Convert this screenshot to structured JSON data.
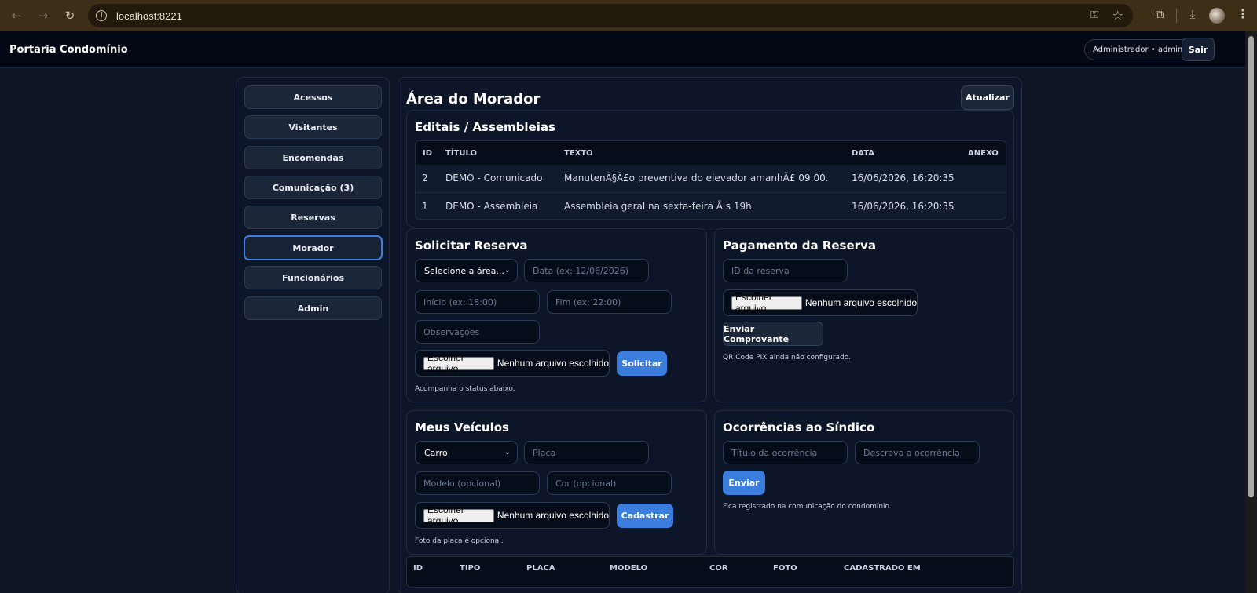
{
  "browser": {
    "url": "localhost:8221"
  },
  "header": {
    "brand": "Portaria Condomínio",
    "user": "Administrador • admin",
    "logout": "Sair"
  },
  "sidebar": {
    "items": [
      {
        "label": "Acessos"
      },
      {
        "label": "Visitantes"
      },
      {
        "label": "Encomendas"
      },
      {
        "label": "Comunicação (3)"
      },
      {
        "label": "Reservas"
      },
      {
        "label": "Morador",
        "active": true
      },
      {
        "label": "Funcionários"
      },
      {
        "label": "Admin"
      }
    ]
  },
  "main": {
    "title": "Área do Morador",
    "refresh": "Atualizar",
    "notices": {
      "title": "Editais / Assembleias",
      "columns": [
        "ID",
        "TÍTULO",
        "TEXTO",
        "DATA",
        "ANEXO"
      ],
      "rows": [
        {
          "id": "2",
          "title": "DEMO - Comunicado",
          "text": "ManutenÃ§Ã£o preventiva do elevador amanhÃ£ 09:00.",
          "date": "16/06/2026, 16:20:35",
          "attachment": ""
        },
        {
          "id": "1",
          "title": "DEMO - Assembleia",
          "text": "Assembleia geral na sexta-feira Ã s 19h.",
          "date": "16/06/2026, 16:20:35",
          "attachment": ""
        }
      ]
    },
    "reservation": {
      "title": "Solicitar Reserva",
      "area_select": "Selecione a área...",
      "date_placeholder": "Data (ex: 12/06/2026)",
      "start_placeholder": "Início (ex: 18:00)",
      "end_placeholder": "Fim (ex: 22:00)",
      "notes_placeholder": "Observações",
      "file_button": "Escolher arquivo",
      "file_status": "Nenhum arquivo escolhido",
      "submit": "Solicitar",
      "hint": "Acompanha o status abaixo."
    },
    "payment": {
      "title": "Pagamento da Reserva",
      "id_placeholder": "ID da reserva",
      "file_button": "Escolher arquivo",
      "file_status": "Nenhum arquivo escolhido",
      "submit": "Enviar Comprovante",
      "hint": "QR Code PIX ainda não configurado."
    },
    "vehicles": {
      "title": "Meus Veículos",
      "type_select": "Carro",
      "plate_placeholder": "Placa",
      "model_placeholder": "Modelo (opcional)",
      "color_placeholder": "Cor (opcional)",
      "file_button": "Escolher arquivo",
      "file_status": "Nenhum arquivo escolhido",
      "submit": "Cadastrar",
      "hint": "Foto da placa é opcional.",
      "columns": [
        "ID",
        "TIPO",
        "PLACA",
        "MODELO",
        "COR",
        "FOTO",
        "CADASTRADO EM"
      ]
    },
    "occurrences": {
      "title": "Ocorrências ao Síndico",
      "title_placeholder": "Título da ocorrência",
      "desc_placeholder": "Descreva a ocorrência",
      "submit": "Enviar",
      "hint": "Fica registrado na comunicação do condomínio."
    }
  },
  "colors": {
    "background": "#0e1626",
    "panel": "#0d1628",
    "accent": "#3a7ddc",
    "chrome": "#3c2e17"
  }
}
